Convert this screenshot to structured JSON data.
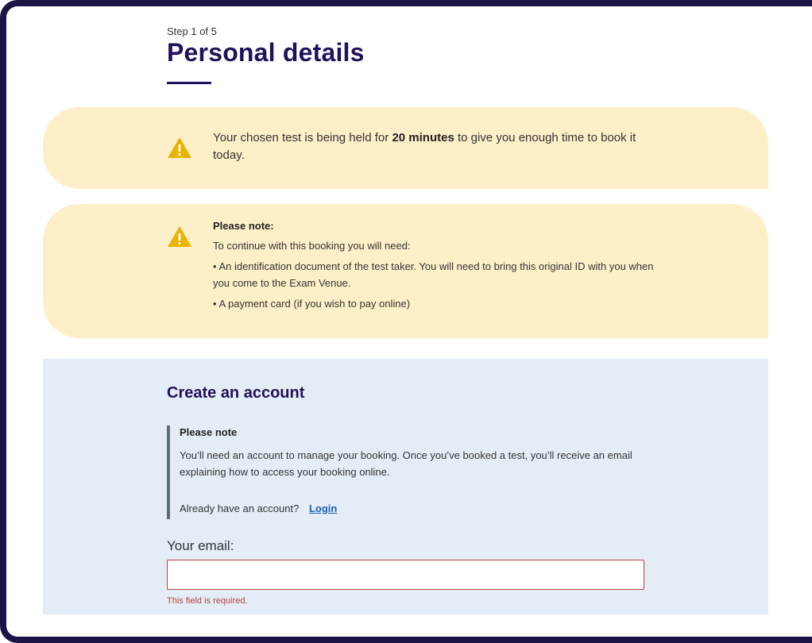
{
  "header": {
    "step": "Step 1 of 5",
    "title": "Personal details"
  },
  "hold_alert": {
    "icon": "warning-icon",
    "text_before": "Your chosen test is being held for ",
    "text_bold": "20 minutes",
    "text_after": " to give you enough time to book it today."
  },
  "note_alert": {
    "icon": "warning-icon",
    "title": "Please note:",
    "intro": "To continue with this booking you will need:",
    "items": [
      "• An identification document of the test taker. You will need to bring this original ID with you when you come to the Exam Venue.",
      "• A payment card (if you wish to pay online)"
    ]
  },
  "account": {
    "title": "Create an account",
    "note_title": "Please note",
    "note_text": "You’ll need an account to manage your booking. Once you’ve booked a test, you’ll receive an email explaining how to access your booking online.",
    "login_prompt": "Already have an account?",
    "login_link": "Login",
    "email_label": "Your email:",
    "email_value": "",
    "email_error": "This field is required."
  },
  "colors": {
    "brand": "#23105b",
    "alert_bg": "#fdefc8",
    "warning": "#e8b400",
    "panel_bg": "#e4edf6",
    "error": "#b2403d",
    "link": "#1a5fb4"
  }
}
